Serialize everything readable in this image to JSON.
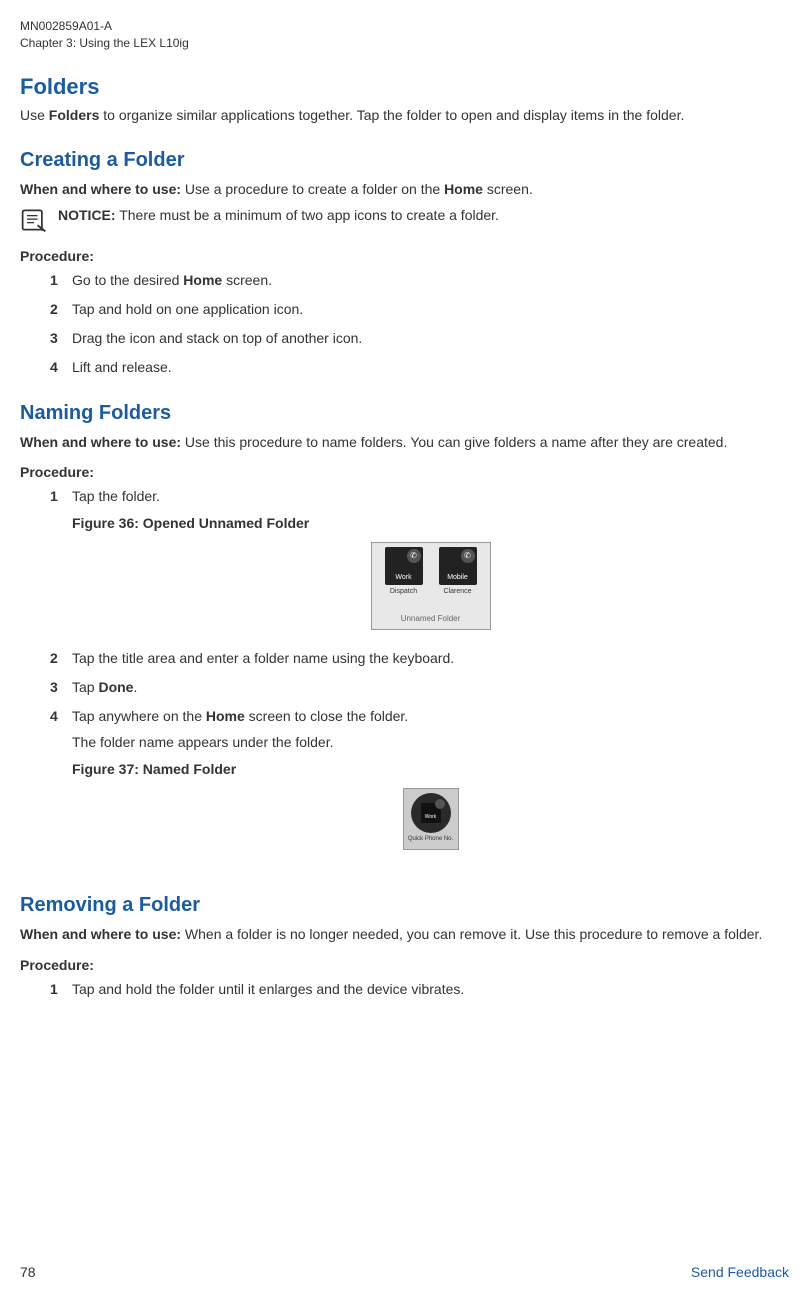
{
  "header": {
    "doc_id": "MN002859A01-A",
    "chapter": "Chapter 3:  Using the LEX L10ig"
  },
  "sections": {
    "folders": {
      "title": "Folders",
      "intro_prefix": "Use ",
      "intro_bold": "Folders",
      "intro_suffix": " to organize similar applications together. Tap the folder to open and display items in the folder."
    },
    "creating": {
      "title": "Creating a Folder",
      "when_label": "When and where to use:",
      "when_text": " Use a procedure to create a folder on the ",
      "when_bold": "Home",
      "when_suffix": " screen.",
      "notice_label": "NOTICE:",
      "notice_text": " There must be a minimum of two app icons to create a folder.",
      "procedure_label": "Procedure:",
      "steps": [
        {
          "pre": "Go to the desired ",
          "bold": "Home",
          "post": " screen."
        },
        {
          "pre": "Tap and hold on one application icon.",
          "bold": "",
          "post": ""
        },
        {
          "pre": "Drag the icon and stack on top of another icon.",
          "bold": "",
          "post": ""
        },
        {
          "pre": "Lift and release.",
          "bold": "",
          "post": ""
        }
      ]
    },
    "naming": {
      "title": "Naming Folders",
      "when_label": "When and where to use:",
      "when_text": " Use this procedure to name folders. You can give folders a name after they are created.",
      "procedure_label": "Procedure:",
      "step1": "Tap the folder.",
      "fig36_caption": "Figure 36: Opened Unnamed Folder",
      "fig36": {
        "app1": "Work",
        "app1_sub": "Dispatch",
        "app2": "Mobile",
        "app2_sub": "Clarence",
        "folder_title": "Unnamed Folder"
      },
      "step2": "Tap the title area and enter a folder name using the keyboard.",
      "step3_pre": "Tap ",
      "step3_bold": "Done",
      "step3_post": ".",
      "step4_pre": "Tap anywhere on the ",
      "step4_bold": "Home",
      "step4_post": " screen to close the folder.",
      "step4_after": "The folder name appears under the folder.",
      "fig37_caption": "Figure 37: Named Folder",
      "fig37": {
        "inner": "Work",
        "label": "Quick Phone No."
      }
    },
    "removing": {
      "title": "Removing a Folder",
      "when_label": "When and where to use:",
      "when_text": " When a folder is no longer needed, you can remove it. Use this procedure to remove a folder.",
      "procedure_label": "Procedure:",
      "step1": "Tap and hold the folder until it enlarges and the device vibrates."
    }
  },
  "footer": {
    "page": "78",
    "feedback": "Send Feedback"
  }
}
